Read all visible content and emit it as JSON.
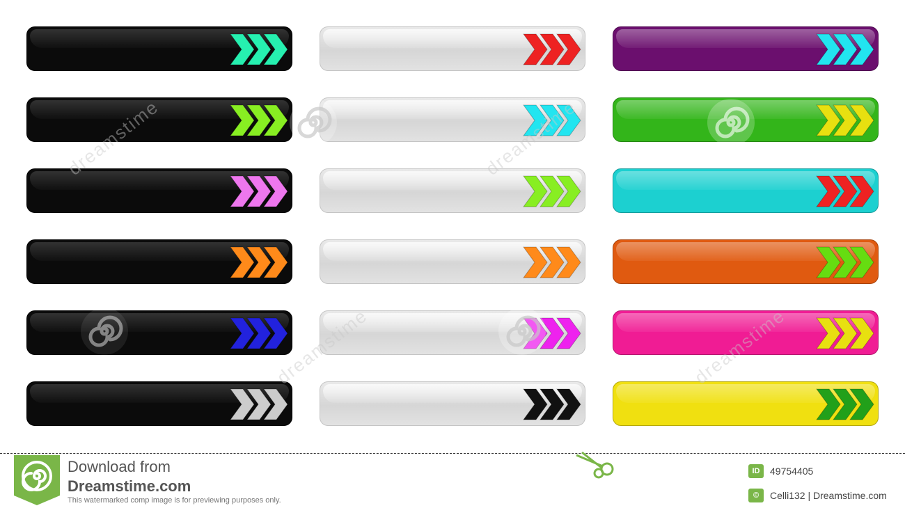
{
  "colors": {
    "black_button_bg": "#0b0b0b",
    "silver_button_bg": "#d9d9d9",
    "dreamstime_green": "#7ab648"
  },
  "buttons": {
    "column_black": [
      {
        "bg": "#0b0b0b",
        "arrow": "#26f0b0"
      },
      {
        "bg": "#0b0b0b",
        "arrow": "#88ee22"
      },
      {
        "bg": "#0b0b0b",
        "arrow": "#ee77ee"
      },
      {
        "bg": "#0b0b0b",
        "arrow": "#ff8a1a"
      },
      {
        "bg": "#0b0b0b",
        "arrow": "#2222dd"
      },
      {
        "bg": "#0b0b0b",
        "arrow": "#cccccc"
      }
    ],
    "column_silver": [
      {
        "bg": "#dcdcdc",
        "arrow": "#ee2222"
      },
      {
        "bg": "#dcdcdc",
        "arrow": "#22e5f0"
      },
      {
        "bg": "#dcdcdc",
        "arrow": "#88ee22"
      },
      {
        "bg": "#dcdcdc",
        "arrow": "#ff8a1a"
      },
      {
        "bg": "#dcdcdc",
        "arrow": "#ee22ee"
      },
      {
        "bg": "#dcdcdc",
        "arrow": "#111111"
      }
    ],
    "column_color": [
      {
        "bg": "#6b0f6e",
        "arrow": "#22e5f0"
      },
      {
        "bg": "#33b51a",
        "arrow": "#e8e010"
      },
      {
        "bg": "#1cd0d0",
        "arrow": "#ee2222"
      },
      {
        "bg": "#e05a10",
        "arrow": "#66dd11"
      },
      {
        "bg": "#f01c94",
        "arrow": "#e8e010"
      },
      {
        "bg": "#f0e010",
        "arrow": "#22a01a"
      }
    ]
  },
  "watermark": {
    "text": "dreamstime"
  },
  "footer": {
    "download_from": "Download from",
    "brand": "Dreamstime.com",
    "note": "This watermarked comp image is for previewing purposes only.",
    "id_label": "ID",
    "id_value": "49754405",
    "credit_label": "©",
    "credit": "Celli132 | Dreamstime.com",
    "icons": [
      "dreamstime-logo-icon",
      "scissors-icon"
    ]
  }
}
